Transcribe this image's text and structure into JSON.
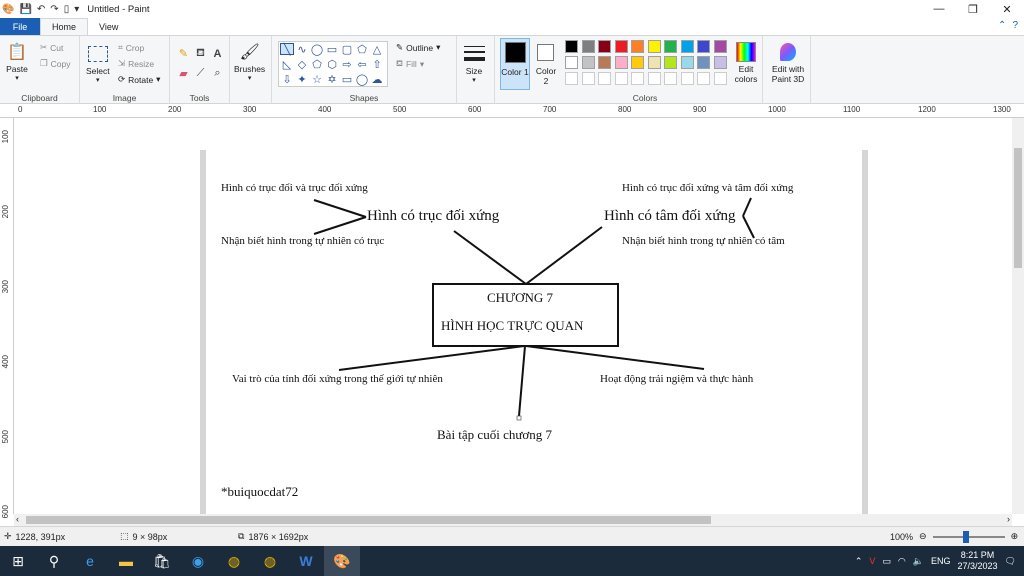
{
  "window": {
    "title": "Untitled - Paint",
    "controls": {
      "minimize": "—",
      "maximize": "❐",
      "close": "✕"
    }
  },
  "tabs": {
    "file": "File",
    "home": "Home",
    "view": "View"
  },
  "ribbon": {
    "clipboard": {
      "label": "Clipboard",
      "paste": "Paste",
      "cut": "Cut",
      "copy": "Copy"
    },
    "image": {
      "label": "Image",
      "select": "Select",
      "crop": "Crop",
      "resize": "Resize",
      "rotate": "Rotate"
    },
    "tools": {
      "label": "Tools"
    },
    "brushes": {
      "label": "Brushes"
    },
    "shapes": {
      "label": "Shapes",
      "outline": "Outline",
      "fill": "Fill"
    },
    "size": {
      "label": "Size"
    },
    "color1": {
      "label": "Color 1"
    },
    "color2": {
      "label": "Color 2"
    },
    "colors": {
      "label": "Colors",
      "row1": [
        "#000000",
        "#7f7f7f",
        "#880015",
        "#ed1c24",
        "#ff7f27",
        "#fff200",
        "#22b14c",
        "#00a2e8",
        "#3f48cc",
        "#a349a4"
      ],
      "row2": [
        "#ffffff",
        "#c3c3c3",
        "#b97a57",
        "#ffaec9",
        "#ffc90e",
        "#efe4b0",
        "#b5e61d",
        "#99d9ea",
        "#7092be",
        "#c8bfe7"
      ]
    },
    "edit_colors": "Edit colors",
    "edit_paint3d": "Edit with Paint 3D"
  },
  "ruler": {
    "h": [
      "0",
      "100",
      "200",
      "300",
      "400",
      "500",
      "600",
      "700",
      "800",
      "900",
      "1000",
      "1100",
      "1200",
      "1300"
    ],
    "v": [
      "100",
      "200",
      "300",
      "400",
      "500",
      "600"
    ]
  },
  "canvas": {
    "center_line1": "CHƯƠNG 7",
    "center_line2": "HÌNH HỌC TRỰC QUAN",
    "node_top_left": "Hình có trục đối xứng",
    "node_top_right": "Hình có tâm đối xứng",
    "leaf_tl_1": "Hình có trục đối và trục đối xứng",
    "leaf_tl_2": "Nhận biết hình trong tự nhiên có trục",
    "leaf_tr_1": "Hình có trục đối xứng và tâm đối xứng",
    "leaf_tr_2": "Nhận biết hình trong tự nhiên có tâm",
    "node_bottom_left": "Vai trò của tính đối xứng trong thế giới tự nhiên",
    "node_bottom_right": "Hoạt động trải ngiệm và thực hành",
    "node_bottom": "Bài tập cuối chương 7",
    "signature": "*buiquocdat72"
  },
  "status": {
    "cursor": "1228, 391px",
    "selection": "9 × 98px",
    "image_size": "1876 × 1692px",
    "zoom": "100%"
  },
  "taskbar": {
    "lang": "ENG",
    "time": "8:21 PM",
    "date": "27/3/2023"
  }
}
